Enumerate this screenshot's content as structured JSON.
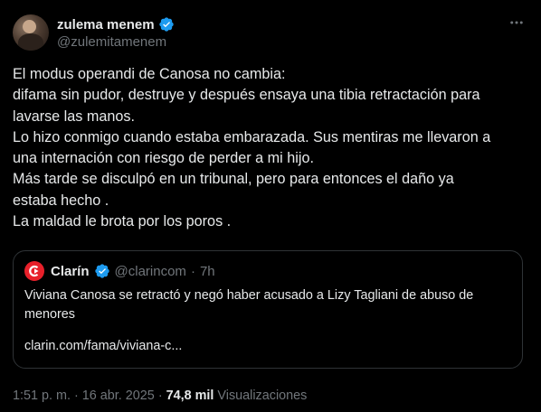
{
  "tweet": {
    "author": {
      "display_name": "zulema menem",
      "handle": "@zulemitamenem",
      "verified_icon": "verified-badge-icon",
      "avatar": "profile-photo"
    },
    "more_icon": "more-options-icon",
    "lines": [
      "El modus operandi de Canosa no cambia:",
      "difama sin pudor, destruye y después ensaya una tibia retractación para",
      "lavarse las manos.",
      "Lo hizo conmigo cuando estaba embarazada. Sus mentiras me llevaron a",
      "una internación con riesgo de perder a mi hijo.",
      "Más tarde se disculpó en un tribunal, pero para entonces el daño ya",
      "estaba hecho .",
      "La maldad le brota por los poros ."
    ],
    "quote": {
      "author": "Clarín",
      "handle": "@clarincom",
      "separator": "·",
      "time": "7h",
      "logo_icon": "clarin-logo-icon",
      "text": "Viviana Canosa se retractó y negó haber acusado a Lizy Tagliani de abuso de menores",
      "link": "clarin.com/fama/viviana-c..."
    },
    "footer": {
      "time": "1:51 p. m. · 16 abr. 2025",
      "dot": "·",
      "views_count": "74,8 mil",
      "views_label": "Visualizaciones"
    }
  },
  "colors": {
    "background": "#000000",
    "text": "#e7e9ea",
    "muted": "#71767b",
    "border": "#2f3336",
    "verified": "#1d9bf0",
    "clarin_red": "#e8202a"
  }
}
